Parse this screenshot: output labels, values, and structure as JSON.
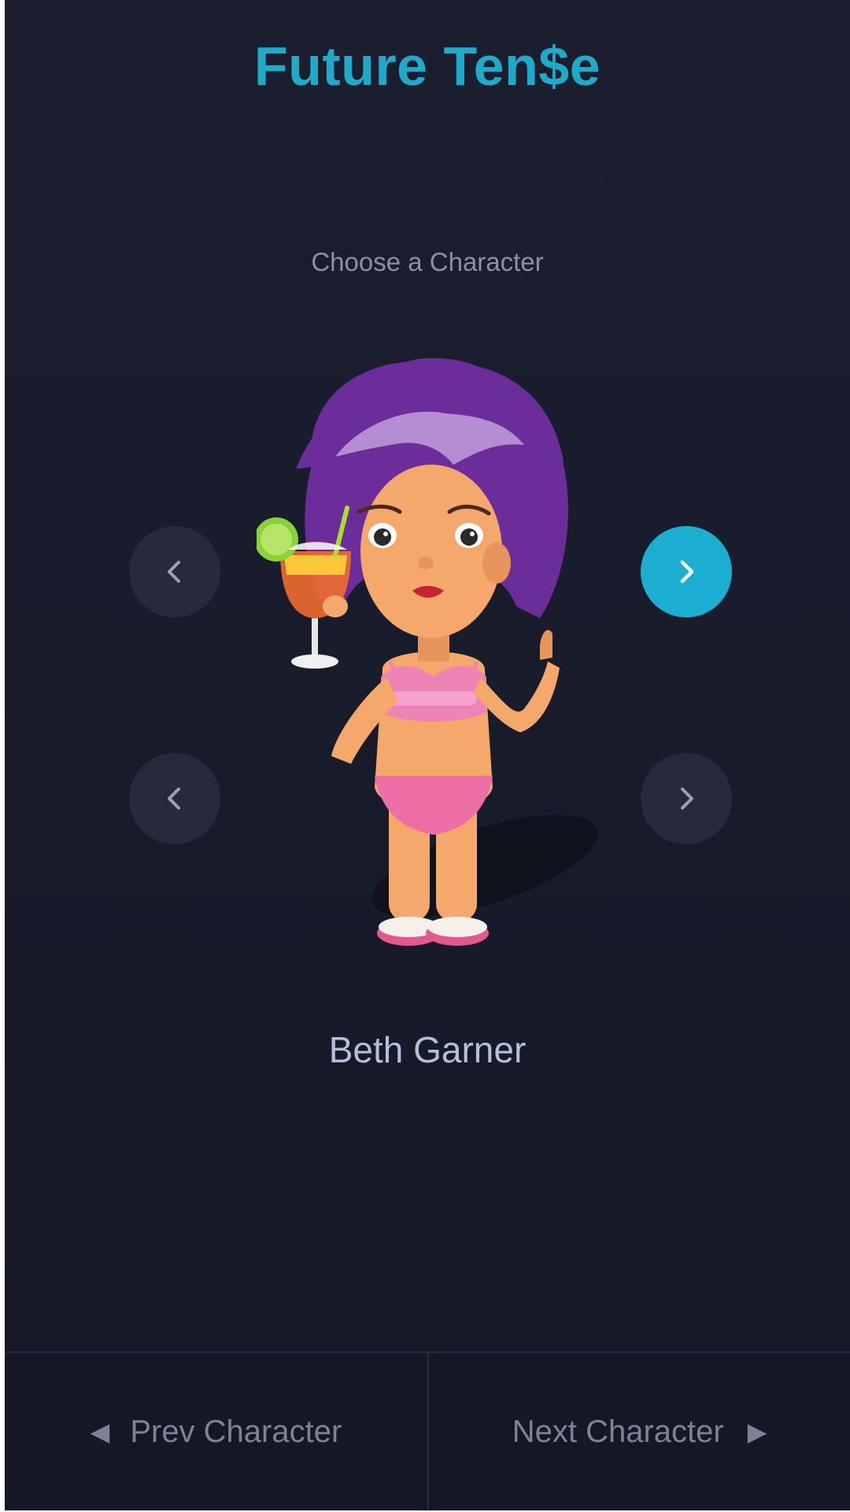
{
  "header": {
    "title": "Future Ten$e"
  },
  "picker": {
    "subtitle": "Choose a Character",
    "character_name": "Beth Garner",
    "nav_buttons": [
      {
        "name": "prev-arrow-top",
        "icon": "chevron-left-icon",
        "active": false
      },
      {
        "name": "next-arrow-top",
        "icon": "chevron-right-icon",
        "active": true
      },
      {
        "name": "prev-arrow-bottom",
        "icon": "chevron-left-icon",
        "active": false
      },
      {
        "name": "next-arrow-bottom",
        "icon": "chevron-right-icon",
        "active": false
      }
    ]
  },
  "footer": {
    "prev_label": "Prev Character",
    "next_label": "Next Character",
    "prev_icon": "triangle-left-icon",
    "next_icon": "triangle-right-icon"
  },
  "colors": {
    "accent": "#1eaac9",
    "background": "#1a1e2f",
    "inactive_button": "#262a3a"
  }
}
